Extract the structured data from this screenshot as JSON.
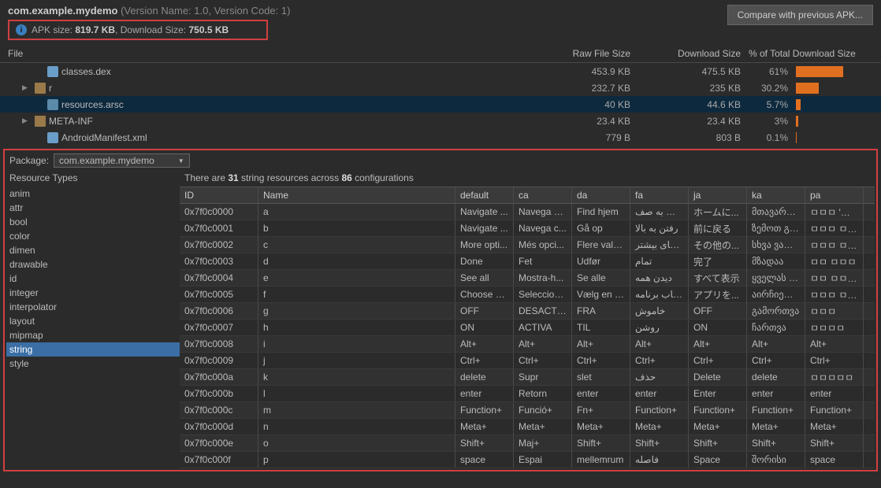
{
  "header": {
    "package_name": "com.example.mydemo",
    "version_name": "1.0",
    "version_code": "1",
    "apk_size_label": "APK size:",
    "apk_size": "819.7 KB",
    "download_size_label": "Download Size:",
    "download_size": "750.5 KB",
    "compare_btn": "Compare with previous APK..."
  },
  "file_table": {
    "headers": {
      "file": "File",
      "raw": "Raw File Size",
      "dl": "Download Size",
      "pct": "% of Total Download Size"
    },
    "rows": [
      {
        "name": "classes.dex",
        "raw": "453.9 KB",
        "dl": "475.5 KB",
        "pct": "61%",
        "bar": 61,
        "icon": "class",
        "indent": 1
      },
      {
        "name": "r",
        "raw": "232.7 KB",
        "dl": "235 KB",
        "pct": "30.2%",
        "bar": 30,
        "icon": "folder",
        "indent": 0,
        "expandable": true
      },
      {
        "name": "resources.arsc",
        "raw": "40 KB",
        "dl": "44.6 KB",
        "pct": "5.7%",
        "bar": 6,
        "icon": "res",
        "indent": 1,
        "selected": true
      },
      {
        "name": "META-INF",
        "raw": "23.4 KB",
        "dl": "23.4 KB",
        "pct": "3%",
        "bar": 3,
        "icon": "folder",
        "indent": 0,
        "expandable": true
      },
      {
        "name": "AndroidManifest.xml",
        "raw": "779 B",
        "dl": "803 B",
        "pct": "0.1%",
        "bar": 1,
        "icon": "xml",
        "indent": 1
      }
    ]
  },
  "package_selector": {
    "label": "Package:",
    "value": "com.example.mydemo"
  },
  "resource_types": {
    "header": "Resource Types",
    "items": [
      "anim",
      "attr",
      "bool",
      "color",
      "dimen",
      "drawable",
      "id",
      "integer",
      "interpolator",
      "layout",
      "mipmap",
      "string",
      "style"
    ],
    "selected": "string"
  },
  "resource_summary": {
    "prefix": "There are ",
    "count": "31",
    "mid": " string resources across ",
    "configs": "86",
    "suffix": " configurations"
  },
  "resource_table": {
    "headers": [
      "ID",
      "Name",
      "default",
      "ca",
      "da",
      "fa",
      "ja",
      "ka",
      "pa"
    ],
    "rows": [
      {
        "id": "0x7f0c0000",
        "name": "a",
        "vals": [
          "Navigate ...",
          "Navega a...",
          "Find hjem",
          "پیمایش به صف...",
          "ホームに...",
          "მთავარზე...",
          "ㅁㅁㅁ 'ㅁㅁ ㅁㅁ"
        ]
      },
      {
        "id": "0x7f0c0001",
        "name": "b",
        "vals": [
          "Navigate ...",
          "Navega c...",
          "Gå op",
          "رفتن به بالا",
          "前に戻る",
          "ზემოთ გა...",
          "ㅁㅁㅁ ㅁㅁㅁ"
        ]
      },
      {
        "id": "0x7f0c0002",
        "name": "c",
        "vals": [
          "More opti...",
          "Més opci...",
          "Flere valg...",
          "گزینه‌های بیشتر",
          "その他の...",
          "სხვა ვარია...",
          "ㅁㅁㅁ ㅁㅁㅁㅁ"
        ]
      },
      {
        "id": "0x7f0c0003",
        "name": "d",
        "vals": [
          "Done",
          "Fet",
          "Udfør",
          "تمام",
          "完了",
          "მზადაა",
          "ㅁㅁ ㅁㅁㅁ"
        ]
      },
      {
        "id": "0x7f0c0004",
        "name": "e",
        "vals": [
          "See all",
          "Mostra-h...",
          "Se alle",
          "دیدن همه",
          "すべて表示",
          "ყველას ნახ...",
          "ㅁㅁ ㅁㅁㅁㅁ"
        ]
      },
      {
        "id": "0x7f0c0005",
        "name": "f",
        "vals": [
          "Choose a...",
          "Seleccion...",
          "Vælg en a...",
          "انتخاب برنامه",
          "アプリを...",
          "აირჩიეთ ა...",
          "ㅁㅁㅁ ㅁㅁ ㅁㅁ"
        ]
      },
      {
        "id": "0x7f0c0006",
        "name": "g",
        "vals": [
          "OFF",
          "DESACTIVA",
          "FRA",
          "خاموش",
          "OFF",
          "გამორთვა",
          "ㅁㅁㅁ"
        ]
      },
      {
        "id": "0x7f0c0007",
        "name": "h",
        "vals": [
          "ON",
          "ACTIVA",
          "TIL",
          "روشن",
          "ON",
          "ჩართვა",
          "ㅁㅁㅁㅁ"
        ]
      },
      {
        "id": "0x7f0c0008",
        "name": "i",
        "vals": [
          "Alt+",
          "Alt+",
          "Alt+",
          "Alt+",
          "Alt+",
          "Alt+",
          "Alt+"
        ]
      },
      {
        "id": "0x7f0c0009",
        "name": "j",
        "vals": [
          "Ctrl+",
          "Ctrl+",
          "Ctrl+",
          "Ctrl+",
          "Ctrl+",
          "Ctrl+",
          "Ctrl+"
        ]
      },
      {
        "id": "0x7f0c000a",
        "name": "k",
        "vals": [
          "delete",
          "Supr",
          "slet",
          "حذف",
          "Delete",
          "delete",
          "ㅁㅁㅁㅁㅁ"
        ]
      },
      {
        "id": "0x7f0c000b",
        "name": "l",
        "vals": [
          "enter",
          "Retorn",
          "enter",
          "enter",
          "Enter",
          "enter",
          "enter"
        ]
      },
      {
        "id": "0x7f0c000c",
        "name": "m",
        "vals": [
          "Function+",
          "Funció+",
          "Fn+",
          "Function+",
          "Function+",
          "Function+",
          "Function+"
        ]
      },
      {
        "id": "0x7f0c000d",
        "name": "n",
        "vals": [
          "Meta+",
          "Meta+",
          "Meta+",
          "Meta+",
          "Meta+",
          "Meta+",
          "Meta+"
        ]
      },
      {
        "id": "0x7f0c000e",
        "name": "o",
        "vals": [
          "Shift+",
          "Maj+",
          "Shift+",
          "Shift+",
          "Shift+",
          "Shift+",
          "Shift+"
        ]
      },
      {
        "id": "0x7f0c000f",
        "name": "p",
        "vals": [
          "space",
          "Espai",
          "mellemrum",
          "فاصله",
          "Space",
          "შორისი",
          "space"
        ]
      }
    ]
  }
}
